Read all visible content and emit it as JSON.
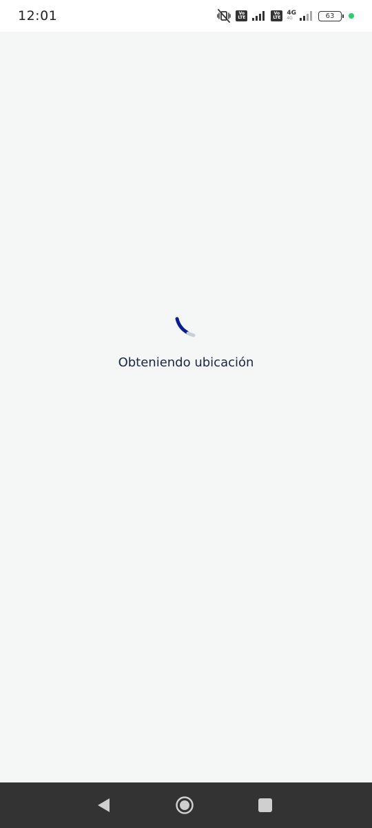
{
  "status_bar": {
    "time": "12:01",
    "volte1": {
      "top": "Vo",
      "bottom": "LTE"
    },
    "volte2": {
      "top": "Vo",
      "bottom": "LTE"
    },
    "network_type": "4G",
    "network_sub": "4G",
    "battery_level": "63",
    "icons": [
      "mute-vibrate-icon",
      "volte-icon",
      "signal-icon",
      "volte-icon",
      "4g-icon",
      "signal-icon",
      "battery-icon",
      "privacy-dot"
    ]
  },
  "main": {
    "loading_text": "Obteniendo ubicación",
    "spinner_color": "#0a1f8f",
    "spinner_track_color": "#c8cdd6"
  },
  "nav_bar": {
    "buttons": [
      "back-icon",
      "home-icon",
      "recents-icon"
    ]
  },
  "colors": {
    "background": "#f5f7f7",
    "status_bar": "#ffffff",
    "nav_bar": "#333333",
    "accent": "#0a1f8f"
  }
}
